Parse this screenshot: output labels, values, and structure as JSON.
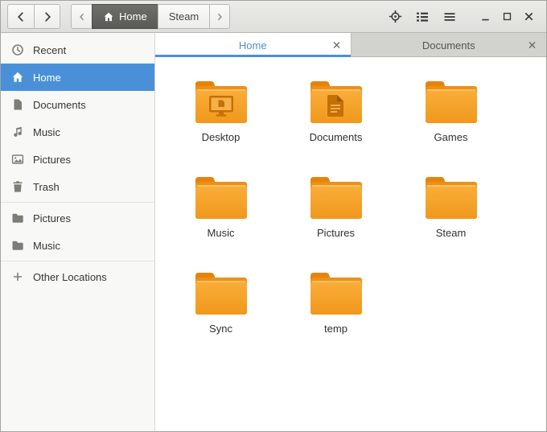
{
  "headerbar": {
    "pathbar": {
      "segments": [
        {
          "label": "Home",
          "active": true
        },
        {
          "label": "Steam",
          "active": false
        }
      ]
    }
  },
  "tabs": [
    {
      "label": "Home",
      "active": true
    },
    {
      "label": "Documents",
      "active": false
    }
  ],
  "sidebar": {
    "places": [
      {
        "label": "Recent",
        "selected": false
      },
      {
        "label": "Home",
        "selected": true
      },
      {
        "label": "Documents",
        "selected": false
      },
      {
        "label": "Music",
        "selected": false
      },
      {
        "label": "Pictures",
        "selected": false
      },
      {
        "label": "Trash",
        "selected": false
      }
    ],
    "bookmarks": [
      {
        "label": "Pictures"
      },
      {
        "label": "Music"
      }
    ],
    "other_locations": "Other Locations"
  },
  "files": [
    {
      "name": "Desktop",
      "emblem": "desktop"
    },
    {
      "name": "Documents",
      "emblem": "document"
    },
    {
      "name": "Games",
      "emblem": ""
    },
    {
      "name": "Music",
      "emblem": ""
    },
    {
      "name": "Pictures",
      "emblem": ""
    },
    {
      "name": "Steam",
      "emblem": ""
    },
    {
      "name": "Sync",
      "emblem": ""
    },
    {
      "name": "temp",
      "emblem": ""
    }
  ],
  "icons": {
    "back": "chevron-left",
    "forward": "chevron-right",
    "home": "house",
    "location": "crosshair-target",
    "view": "list-view",
    "menu": "hamburger",
    "minimize": "underscore",
    "maximize": "square-outline",
    "close": "cross",
    "recent": "clock",
    "documents": "document-sheet",
    "music": "music-note",
    "pictures": "image-frame",
    "trash": "trash-can",
    "bookmark": "folder",
    "other_locations": "plus",
    "tab_close": "cross",
    "file_icon": "folder"
  },
  "colors": {
    "accent": "#4a90d9",
    "folder_body": "#f5a22b",
    "folder_flap": "#e5830b",
    "folder_emblem": "#c47004",
    "headerbar_bg": "#e5e5e2",
    "sidebar_bg": "#f8f8f7",
    "inactive_tab_bg": "#d2d2cf"
  }
}
